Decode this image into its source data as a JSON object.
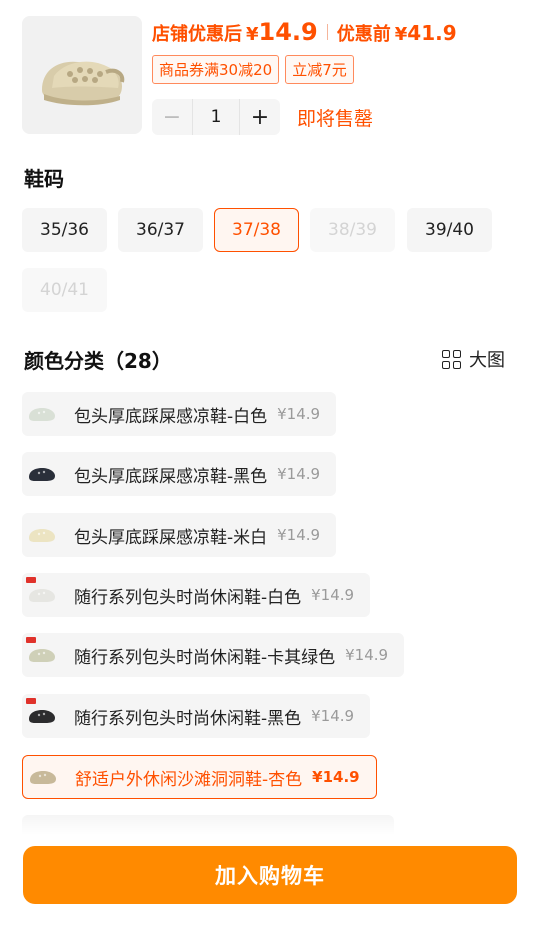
{
  "product": {
    "store_price_label": "店铺优惠后",
    "currency": "¥",
    "store_price": "14.9",
    "original_price_label": "优惠前",
    "original_price": "41.9",
    "coupons": [
      "商品券满30减20",
      "立减7元"
    ]
  },
  "quantity": {
    "minus": "−",
    "value": "1",
    "plus": "+"
  },
  "stock_status": "即将售罄",
  "size_section": {
    "title": "鞋码",
    "options": [
      {
        "label": "35/36",
        "state": "normal"
      },
      {
        "label": "36/37",
        "state": "normal"
      },
      {
        "label": "37/38",
        "state": "selected"
      },
      {
        "label": "38/39",
        "state": "disabled"
      },
      {
        "label": "39/40",
        "state": "normal"
      },
      {
        "label": "40/41",
        "state": "disabled"
      }
    ]
  },
  "color_section": {
    "title": "颜色分类（28）",
    "big_view_label": "大图",
    "options": [
      {
        "name": "包头厚底踩屎感凉鞋-白色",
        "price": "¥14.9",
        "shoe_color": "#d9e0d6"
      },
      {
        "name": "包头厚底踩屎感凉鞋-黑色",
        "price": "¥14.9",
        "shoe_color": "#2a2f3a"
      },
      {
        "name": "包头厚底踩屎感凉鞋-米白",
        "price": "¥14.9",
        "shoe_color": "#ece4c2"
      },
      {
        "name": "随行系列包头时尚休闲鞋-白色",
        "price": "¥14.9",
        "shoe_color": "#e6e6e2"
      },
      {
        "name": "随行系列包头时尚休闲鞋-卡其绿色",
        "price": "¥14.9",
        "shoe_color": "#cfd0b8"
      },
      {
        "name": "随行系列包头时尚休闲鞋-黑色",
        "price": "¥14.9",
        "shoe_color": "#2c2c2e"
      },
      {
        "name": "舒适户外休闲沙滩洞洞鞋-杏色",
        "price": "¥14.9",
        "shoe_color": "#c8b99a"
      }
    ]
  },
  "accent_color": "#ff5000",
  "cart_button": {
    "label": "加入购物车",
    "color": "#ff8a00"
  }
}
